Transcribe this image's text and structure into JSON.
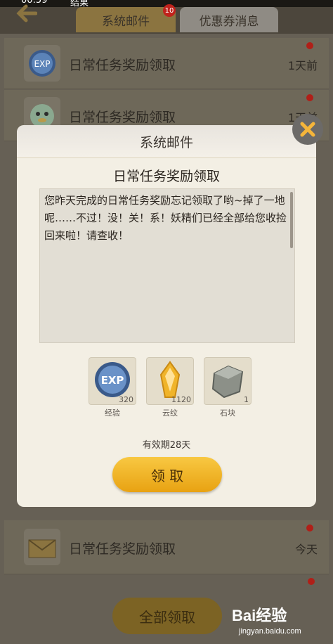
{
  "status": {
    "time": "00:59",
    "text": "结果"
  },
  "tabs": [
    {
      "label": "系统邮件",
      "badge": "10"
    },
    {
      "label": "优惠券消息"
    }
  ],
  "mail_list": [
    {
      "title": "日常任务奖励领取",
      "time": "1天前",
      "icon": "exp-icon"
    },
    {
      "title": "日常任务奖励领取",
      "time": "1天前",
      "icon": "mascot-icon"
    },
    {
      "title": "日常任务奖励领取",
      "time": "今天",
      "icon": "envelope-icon"
    }
  ],
  "modal": {
    "title": "系统邮件",
    "subject": "日常任务奖励领取",
    "body": "您昨天完成的日常任务奖励忘记领取了哟~掉了一地呢……不过！没！关！系！妖精们已经全部给您收捡回来啦！请查收！",
    "rewards": [
      {
        "label": "经验",
        "count": "320",
        "icon": "exp-icon"
      },
      {
        "label": "云纹",
        "count": "1120",
        "icon": "crystal-icon"
      },
      {
        "label": "石块",
        "count": "1",
        "icon": "stone-icon"
      }
    ],
    "validity": "有效期28天",
    "claim_label": "领 取"
  },
  "bottom": {
    "claim_all_label": "全部领取"
  },
  "watermark": {
    "logo": "Bai经验",
    "sub": "jingyan.baidu.com"
  },
  "colors": {
    "accent": "#f0b42a",
    "badge": "#c0221c"
  }
}
